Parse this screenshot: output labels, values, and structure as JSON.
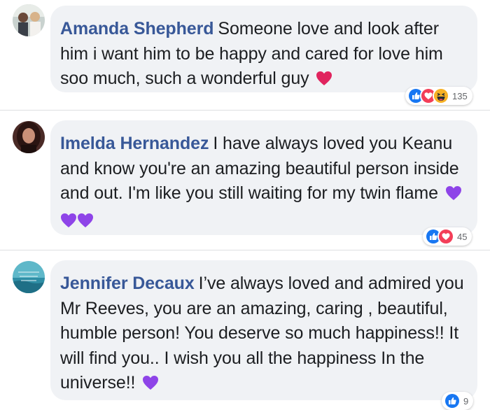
{
  "comments": [
    {
      "author": "Amanda Shepherd",
      "text": "Someone love and look after him i want him to be happy and cared for love him soo much, such a wonderful guy",
      "emoji": [
        "red-heart"
      ],
      "reactions": [
        "like",
        "love",
        "haha"
      ],
      "reaction_count": "135"
    },
    {
      "author": "Imelda Hernandez",
      "text": "I have always loved you Keanu and know you're an amazing beautiful person inside and out. I'm like you still waiting for my twin flame",
      "emoji": [
        "purple-heart",
        "purple-heart",
        "purple-heart"
      ],
      "reactions": [
        "like",
        "love"
      ],
      "reaction_count": "45"
    },
    {
      "author": "Jennifer Decaux",
      "text": "I’ve always loved and admired you Mr Reeves, you are an amazing, caring , beautiful, humble person! You deserve so much happiness!! It will find you.. I wish you all the happiness In the universe!!",
      "emoji": [
        "purple-heart"
      ],
      "reactions": [
        "like"
      ],
      "reaction_count": "9"
    }
  ],
  "colors": {
    "author": "#385898",
    "bubble": "#f0f2f5",
    "like": "#1877f2",
    "love": "#f33e58",
    "haha": "#f7b125",
    "purple_heart": "#8e44e8",
    "red_heart": "#e0245e"
  }
}
